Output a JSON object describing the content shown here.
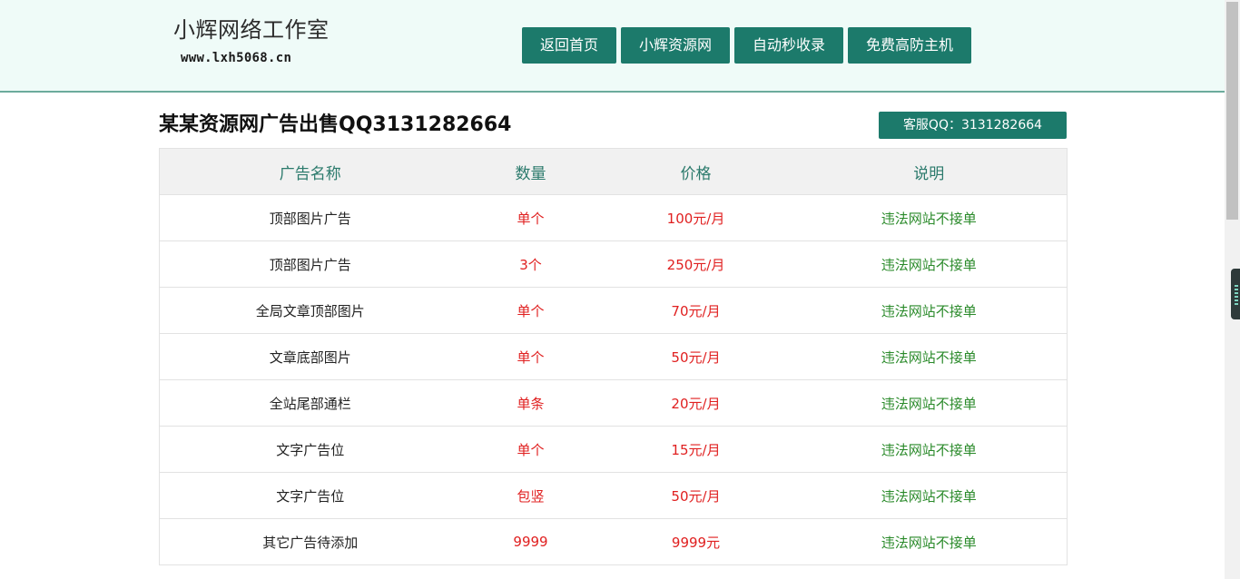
{
  "header": {
    "logo_title": "小辉网络工作室",
    "logo_url": "www.lxh5068.cn",
    "nav": [
      "返回首页",
      "小辉资源网",
      "自动秒收录",
      "免费高防主机"
    ]
  },
  "main": {
    "title": "某某资源网广告出售QQ3131282664",
    "kefu_label": "客服QQ：3131282664",
    "table": {
      "headers": [
        "广告名称",
        "数量",
        "价格",
        "说明"
      ],
      "rows": [
        [
          "顶部图片广告",
          "单个",
          "100元/月",
          "违法网站不接单"
        ],
        [
          "顶部图片广告",
          "3个",
          "250元/月",
          "违法网站不接单"
        ],
        [
          "全局文章顶部图片",
          "单个",
          "70元/月",
          "违法网站不接单"
        ],
        [
          "文章底部图片",
          "单个",
          "50元/月",
          "违法网站不接单"
        ],
        [
          "全站尾部通栏",
          "单条",
          "20元/月",
          "违法网站不接单"
        ],
        [
          "文字广告位",
          "单个",
          "15元/月",
          "违法网站不接单"
        ],
        [
          "文字广告位",
          "包竖",
          "50元/月",
          "违法网站不接单"
        ],
        [
          "其它广告待添加",
          "9999",
          "9999元",
          "违法网站不接单"
        ]
      ]
    }
  },
  "colors": {
    "accent": "#1c7a6b",
    "header_bg": "#effbf8",
    "price_red": "#e02020",
    "note_green": "#2a8a2a"
  }
}
